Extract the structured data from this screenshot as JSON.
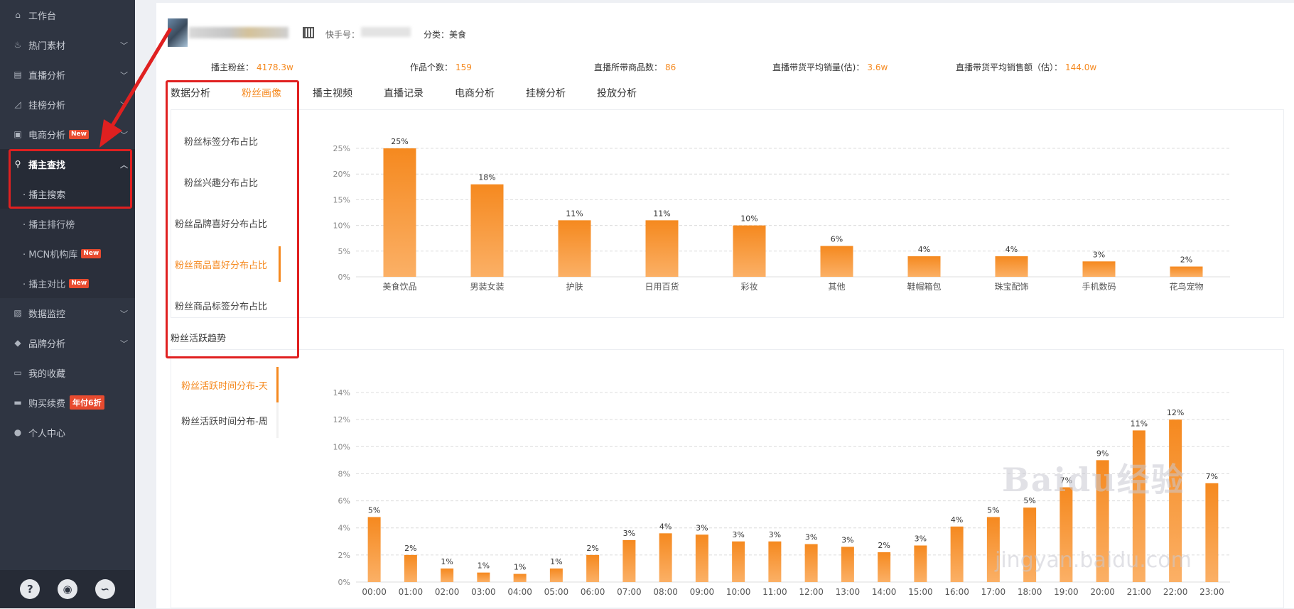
{
  "sidebar": {
    "items": [
      {
        "label": "工作台",
        "icon": "home-icon",
        "chevron": ""
      },
      {
        "label": "热门素材",
        "icon": "flame-icon",
        "chevron": "﹀"
      },
      {
        "label": "直播分析",
        "icon": "bar-chart-icon",
        "chevron": "﹀"
      },
      {
        "label": "挂榜分析",
        "icon": "line-chart-icon",
        "chevron": "﹀"
      },
      {
        "label": "电商分析",
        "icon": "bag-icon",
        "chevron": "﹀",
        "badge": "New"
      },
      {
        "label": "播主查找",
        "icon": "search-icon",
        "chevron": "︿"
      }
    ],
    "subitems": [
      {
        "label": "· 播主搜索"
      },
      {
        "label": "· 播主排行榜"
      },
      {
        "label": "· MCN机构库",
        "badge": "New"
      },
      {
        "label": "· 播主对比",
        "badge": "New"
      }
    ],
    "items_after": [
      {
        "label": "数据监控",
        "icon": "monitor-icon",
        "chevron": "﹀"
      },
      {
        "label": "品牌分析",
        "icon": "brand-icon",
        "chevron": "﹀"
      },
      {
        "label": "我的收藏",
        "icon": "folder-icon",
        "chevron": ""
      },
      {
        "label": "购买续费",
        "icon": "card-icon",
        "chevron": "",
        "badge": "年付6折"
      },
      {
        "label": "个人中心",
        "icon": "user-icon",
        "chevron": ""
      }
    ],
    "bottom": {
      "help": "?",
      "wechat": "◉",
      "link": "∽"
    }
  },
  "profile": {
    "kuaishou_label": "快手号：",
    "category_label": "分类：",
    "category_value": "美食"
  },
  "stats": [
    {
      "label": "播主粉丝：",
      "value": "4178.3w"
    },
    {
      "label": "作品个数：",
      "value": "159"
    },
    {
      "label": "直播所带商品数：",
      "value": "86"
    },
    {
      "label": "直播带货平均销量(估)：",
      "value": "3.6w"
    },
    {
      "label": "直播带货平均销售额（估）：",
      "value": "144.0w"
    }
  ],
  "tabs": [
    "数据分析",
    "粉丝画像",
    "播主视频",
    "直播记录",
    "电商分析",
    "挂榜分析",
    "投放分析"
  ],
  "active_tab": 1,
  "panel1_list": [
    "粉丝标签分布占比",
    "粉丝兴趣分布占比",
    "粉丝品牌喜好分布占比",
    "粉丝商品喜好分布占比",
    "粉丝商品标签分布占比"
  ],
  "panel1_active": 3,
  "section_title": "粉丝活跃趋势",
  "panel2_list": [
    "粉丝活跃时间分布-天",
    "粉丝活跃时间分布-周"
  ],
  "panel2_active": 0,
  "watermark": {
    "text": "Baidu经验",
    "sub": "jingyan.baidu.com"
  },
  "colors": {
    "accent": "#f5891f",
    "sidebar_bg": "#2f3542",
    "annotation_red": "#e02020"
  },
  "chart_data": [
    {
      "type": "bar",
      "categories": [
        "美食饮品",
        "男装女装",
        "护肤",
        "日用百货",
        "彩妆",
        "其他",
        "鞋帽箱包",
        "珠宝配饰",
        "手机数码",
        "花鸟宠物"
      ],
      "values": [
        25,
        18,
        11,
        11,
        10,
        6,
        4,
        4,
        3,
        2
      ],
      "value_labels": [
        "25%",
        "18%",
        "11%",
        "11%",
        "10%",
        "6%",
        "4%",
        "4%",
        "3%",
        "2%"
      ],
      "ylim": [
        0,
        25
      ],
      "yticks": [
        "0%",
        "5%",
        "10%",
        "15%",
        "20%",
        "25%"
      ],
      "grid": true
    },
    {
      "type": "bar",
      "categories": [
        "00:00",
        "01:00",
        "02:00",
        "03:00",
        "04:00",
        "05:00",
        "06:00",
        "07:00",
        "08:00",
        "09:00",
        "10:00",
        "11:00",
        "12:00",
        "13:00",
        "14:00",
        "15:00",
        "16:00",
        "17:00",
        "18:00",
        "19:00",
        "20:00",
        "21:00",
        "22:00",
        "23:00"
      ],
      "values": [
        4.8,
        2,
        1,
        0.7,
        0.6,
        1,
        2,
        3.1,
        3.6,
        3.5,
        3,
        3,
        2.8,
        2.6,
        2.2,
        2.7,
        4.1,
        4.8,
        5.5,
        7,
        9,
        11.2,
        12,
        7.3
      ],
      "value_labels": [
        "5%",
        "2%",
        "1%",
        "1%",
        "1%",
        "1%",
        "2%",
        "3%",
        "4%",
        "3%",
        "3%",
        "3%",
        "3%",
        "3%",
        "2%",
        "3%",
        "4%",
        "5%",
        "5%",
        "7%",
        "9%",
        "11%",
        "12%",
        "7%"
      ],
      "ylim": [
        0,
        14
      ],
      "yticks": [
        "0%",
        "2%",
        "4%",
        "6%",
        "8%",
        "10%",
        "12%",
        "14%"
      ],
      "grid": true
    }
  ]
}
